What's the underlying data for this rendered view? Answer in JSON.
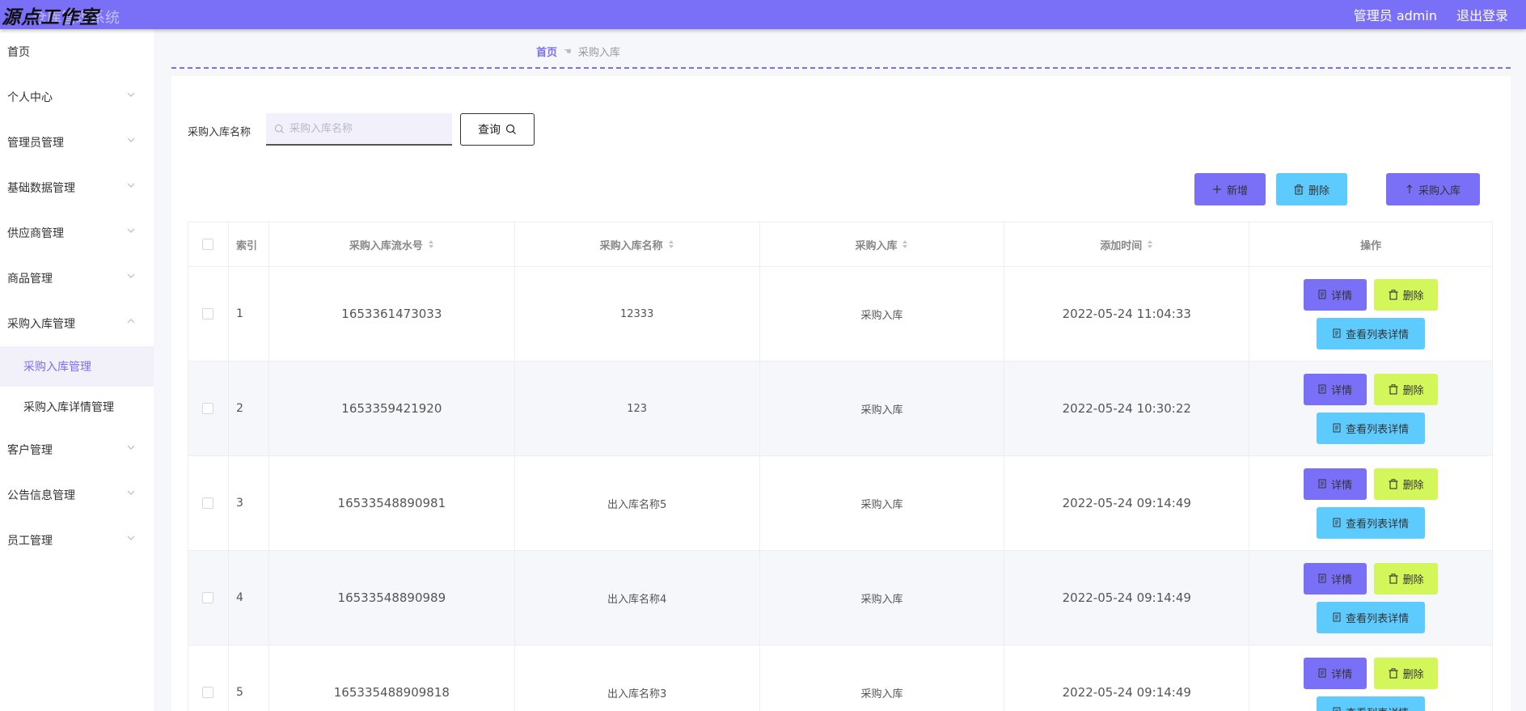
{
  "header": {
    "brand_main": "源点工作室",
    "brand_sub": "仓库管理系统",
    "user": "管理员 admin",
    "logout": "退出登录",
    "accent_color": "#7a6ff7"
  },
  "sidebar": {
    "items": [
      {
        "label": "首页"
      },
      {
        "label": "个人中心"
      },
      {
        "label": "管理员管理"
      },
      {
        "label": "基础数据管理"
      },
      {
        "label": "供应商管理"
      },
      {
        "label": "商品管理"
      },
      {
        "label": "采购入库管理"
      },
      {
        "label": "客户管理"
      },
      {
        "label": "公告信息管理"
      },
      {
        "label": "员工管理"
      }
    ],
    "subitems": [
      {
        "label": "采购入库管理",
        "active": true
      },
      {
        "label": "采购入库详情管理",
        "active": false
      }
    ]
  },
  "breadcrumb": {
    "home": "首页",
    "current": "采购入库"
  },
  "search": {
    "label": "采购入库名称",
    "placeholder": "采购入库名称",
    "value": "",
    "query_label": "查询"
  },
  "actions": {
    "add": "新增",
    "delete": "删除",
    "stock_in": "采购入库"
  },
  "table": {
    "headers": {
      "index": "索引",
      "serial": "采购入库流水号",
      "name": "采购入库名称",
      "type": "采购入库",
      "time": "添加时间",
      "ops": "操作"
    },
    "rows": [
      {
        "index": "1",
        "serial": "1653361473033",
        "name": "12333",
        "type": "采购入库",
        "time": "2022-05-24 11:04:33"
      },
      {
        "index": "2",
        "serial": "1653359421920",
        "name": "123",
        "type": "采购入库",
        "time": "2022-05-24 10:30:22"
      },
      {
        "index": "3",
        "serial": "16533548890981",
        "name": "出入库名称5",
        "type": "采购入库",
        "time": "2022-05-24 09:14:49"
      },
      {
        "index": "4",
        "serial": "16533548890989",
        "name": "出入库名称4",
        "type": "采购入库",
        "time": "2022-05-24 09:14:49"
      },
      {
        "index": "5",
        "serial": "165335488909818",
        "name": "出入库名称3",
        "type": "采购入库",
        "time": "2022-05-24 09:14:49"
      }
    ],
    "row_buttons": {
      "detail": "详情",
      "delete": "删除",
      "list_detail": "查看列表详情"
    }
  },
  "icons": [
    "search-icon",
    "plus-icon",
    "trash-icon",
    "upload-arrow-icon",
    "document-icon",
    "chevron-down-icon",
    "chevron-up-icon",
    "sort-icon",
    "hand-pointer-icon"
  ]
}
